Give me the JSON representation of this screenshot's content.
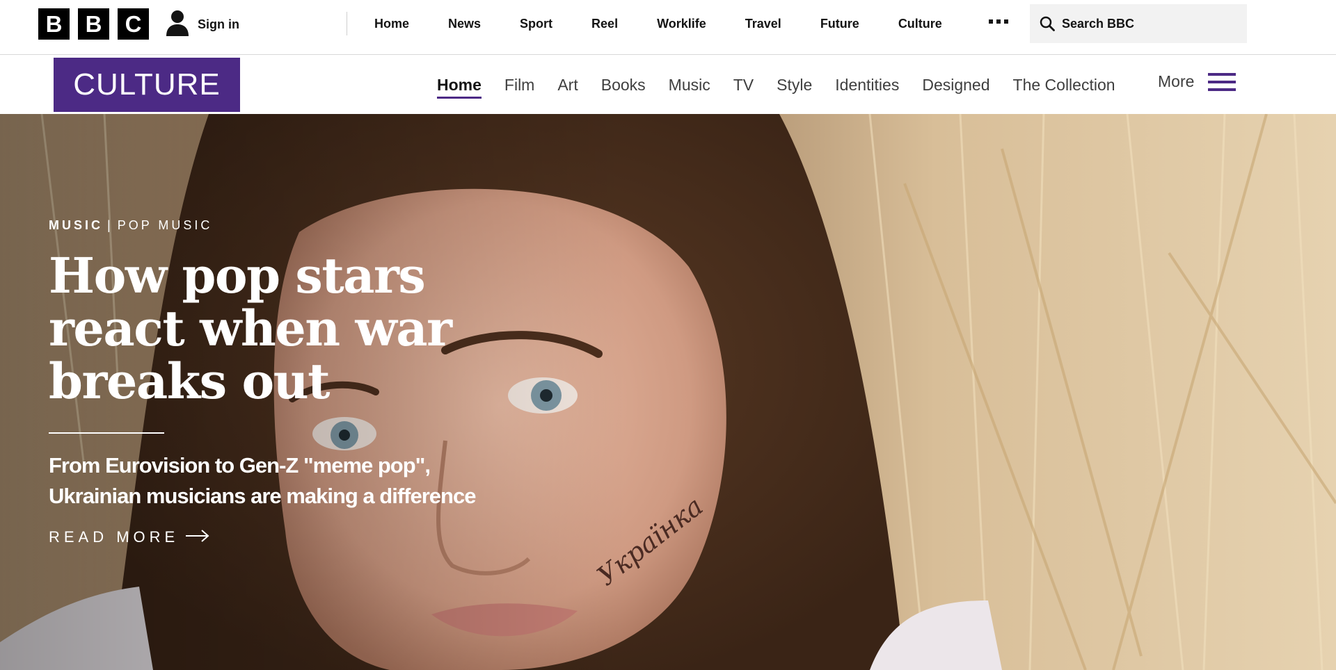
{
  "bbc": {
    "logo_letters": [
      "B",
      "B",
      "C"
    ],
    "sign_in_label": "Sign in",
    "nav": [
      "Home",
      "News",
      "Sport",
      "Reel",
      "Worklife",
      "Travel",
      "Future",
      "Culture"
    ],
    "more_icon": "ellipsis-icon",
    "search_label": "Search BBC"
  },
  "culture": {
    "logo_text": "CULTURE",
    "brand_color": "#4c2a85",
    "nav": [
      {
        "label": "Home",
        "active": true
      },
      {
        "label": "Film",
        "active": false
      },
      {
        "label": "Art",
        "active": false
      },
      {
        "label": "Books",
        "active": false
      },
      {
        "label": "Music",
        "active": false
      },
      {
        "label": "TV",
        "active": false
      },
      {
        "label": "Style",
        "active": false
      },
      {
        "label": "Identities",
        "active": false
      },
      {
        "label": "Designed",
        "active": false
      },
      {
        "label": "The Collection",
        "active": false
      }
    ],
    "more_label": "More",
    "menu_icon": "hamburger-menu-icon"
  },
  "hero": {
    "section": "MUSIC",
    "separator": "|",
    "subsection": "POP MUSIC",
    "headline": "How pop stars react when war breaks out",
    "standfirst": "From Eurovision to Gen-Z \"meme pop\", Ukrainian musicians are making a difference",
    "read_more_label": "READ MORE",
    "read_more_icon": "arrow-right-icon"
  }
}
